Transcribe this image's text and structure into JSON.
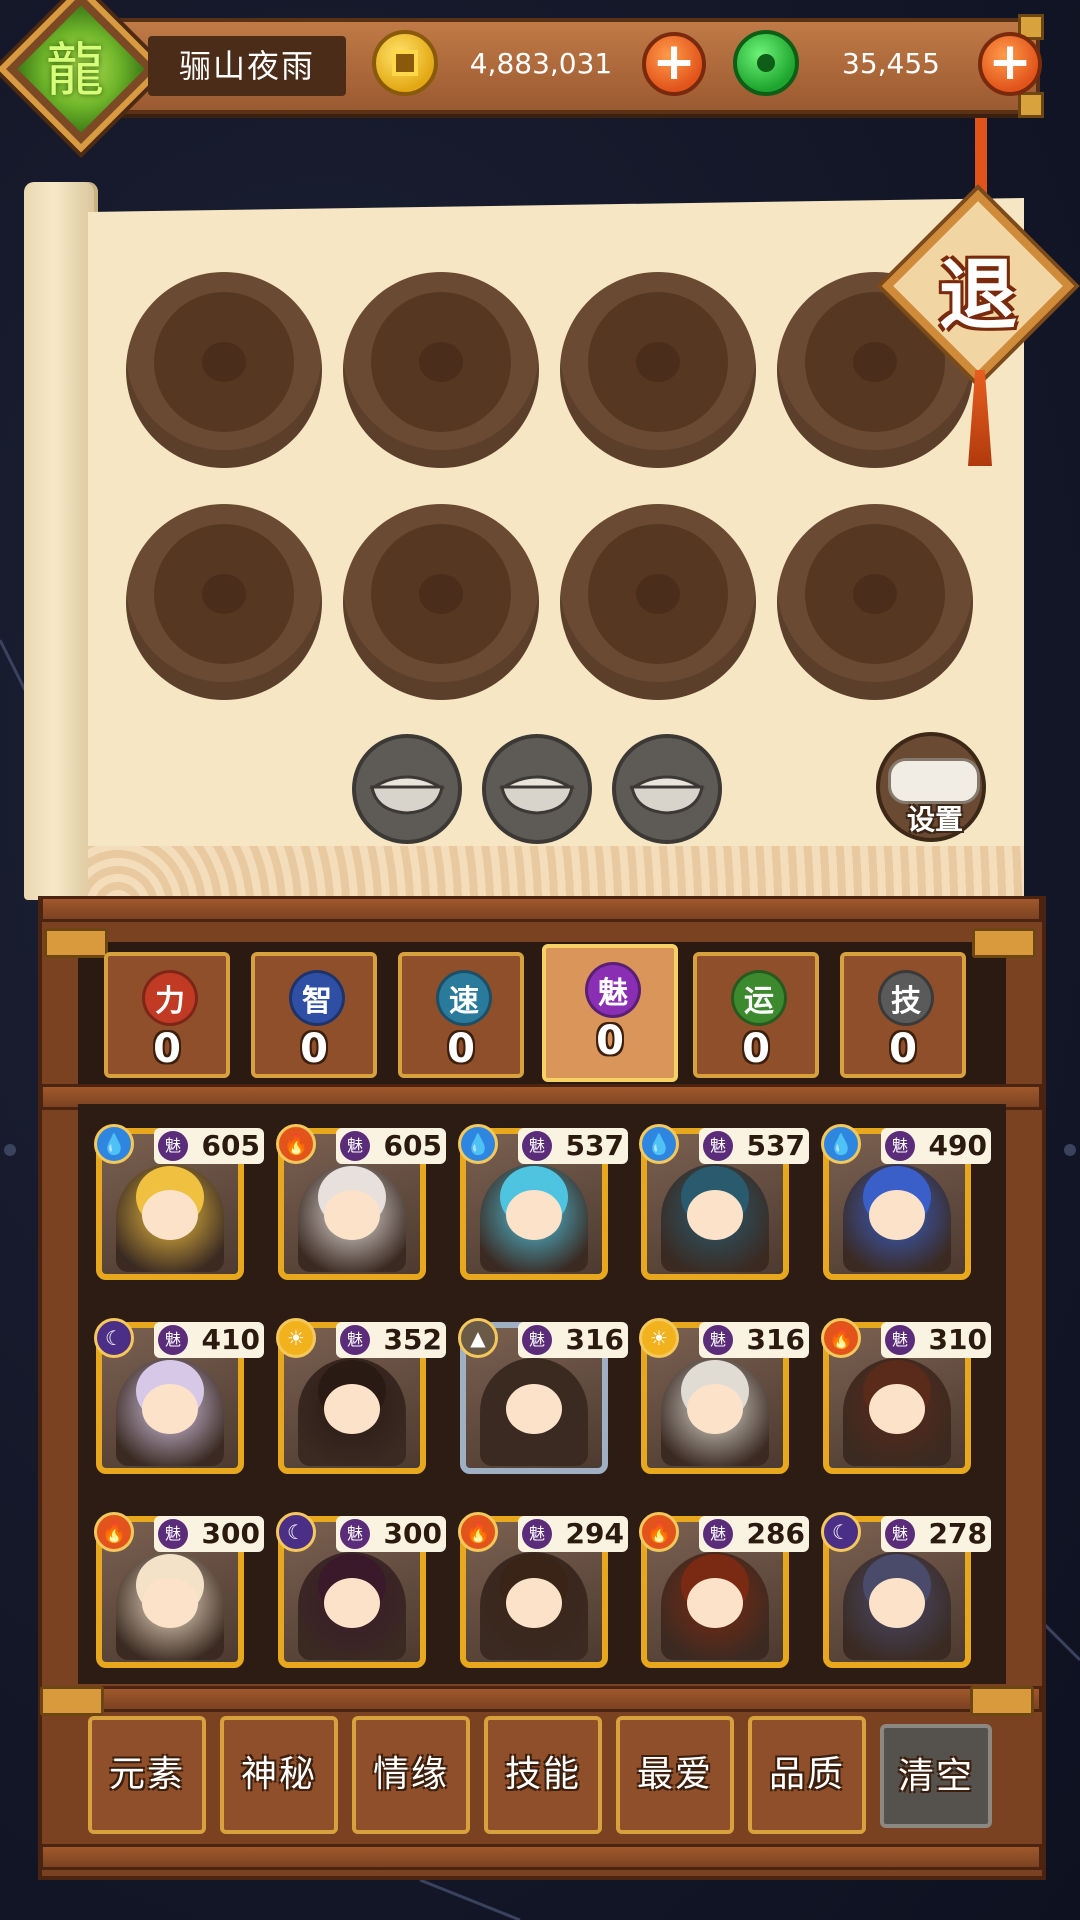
{
  "player": {
    "name": "骊山夜雨",
    "avatar_icon": "green-dragon-icon"
  },
  "currency": {
    "gold": {
      "value": "4,883,031",
      "icon": "gold-coin-icon"
    },
    "jade": {
      "value": "35,455",
      "icon": "jade-coin-icon"
    },
    "plus_label": "+"
  },
  "exit_label": "退",
  "settings_label": "设置",
  "slots": {
    "hero_slots": 8,
    "bowls": 3
  },
  "stat_tabs": [
    {
      "label": "力",
      "value": "0",
      "color": "#c13a24"
    },
    {
      "label": "智",
      "value": "0",
      "color": "#2e4fa3"
    },
    {
      "label": "速",
      "value": "0",
      "color": "#2a7a9c"
    },
    {
      "label": "魅",
      "value": "0",
      "color": "#8a2fb3",
      "active": true
    },
    {
      "label": "运",
      "value": "0",
      "color": "#3d8a2e"
    },
    {
      "label": "技",
      "value": "0",
      "color": "#5a5a5a"
    }
  ],
  "charm_badge": "魅",
  "heroes": [
    {
      "element": "water",
      "score": "605"
    },
    {
      "element": "fire",
      "score": "605"
    },
    {
      "element": "water",
      "score": "537"
    },
    {
      "element": "water",
      "score": "537"
    },
    {
      "element": "water",
      "score": "490"
    },
    {
      "element": "moon",
      "score": "410"
    },
    {
      "element": "sun",
      "score": "352"
    },
    {
      "element": "earth",
      "score": "316"
    },
    {
      "element": "sun",
      "score": "316"
    },
    {
      "element": "fire",
      "score": "310"
    },
    {
      "element": "fire",
      "score": "300"
    },
    {
      "element": "moon",
      "score": "300"
    },
    {
      "element": "fire",
      "score": "294"
    },
    {
      "element": "fire",
      "score": "286"
    },
    {
      "element": "moon",
      "score": "278"
    }
  ],
  "element_colors": {
    "water": "#2f86e0",
    "fire": "#e2541b",
    "moon": "#4b2f86",
    "sun": "#f2b21e",
    "earth": "#6b5a45"
  },
  "filters": [
    "元素",
    "神秘",
    "情缘",
    "技能",
    "最爱",
    "品质"
  ],
  "clear_label": "清空"
}
